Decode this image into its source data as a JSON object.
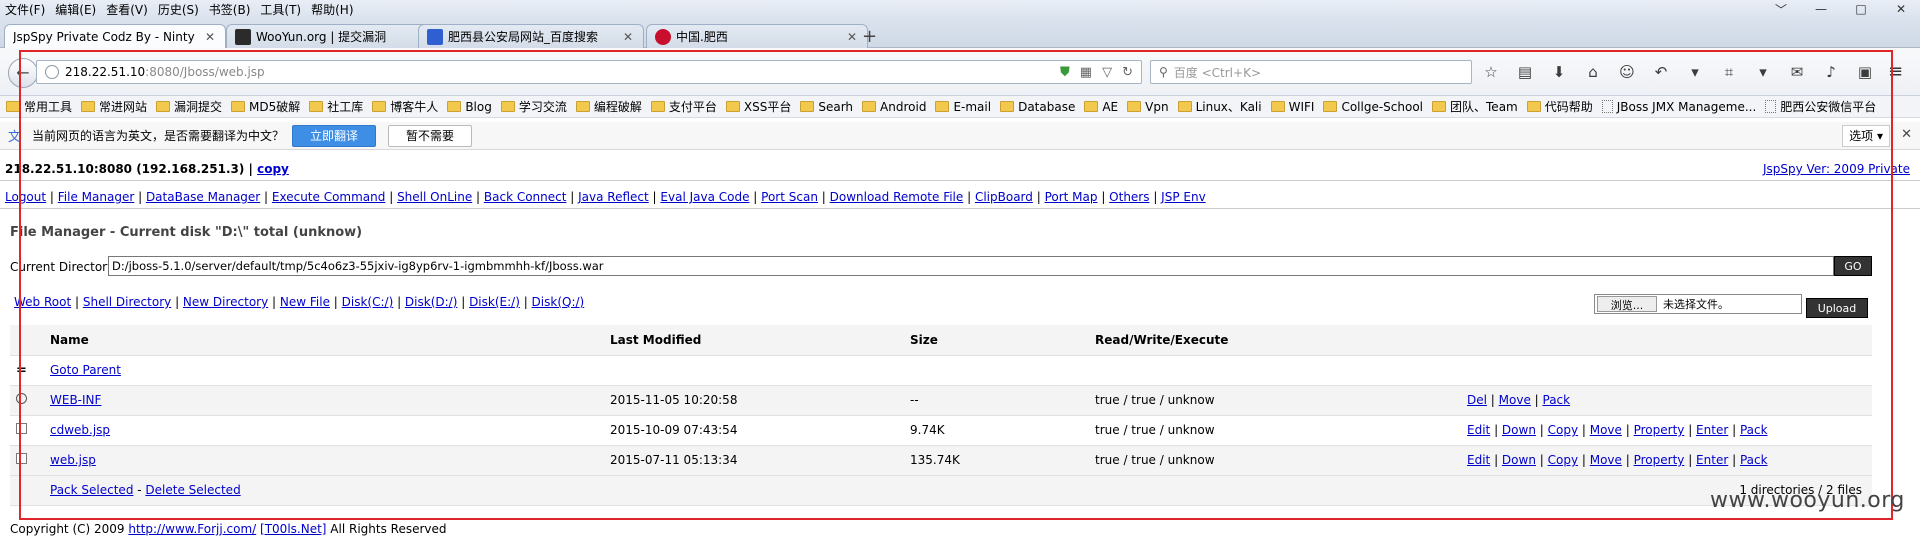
{
  "menubar": {
    "items": [
      "文件(F)",
      "编辑(E)",
      "查看(V)",
      "历史(S)",
      "书签(B)",
      "工具(T)",
      "帮助(H)"
    ],
    "window_controls": [
      "﹀",
      "—",
      "□",
      "✕"
    ]
  },
  "tabs": [
    {
      "label": "JspSpy Private Codz By - Ninty",
      "active": true
    },
    {
      "label": "WooYun.org | 提交漏洞",
      "active": false
    },
    {
      "label": "肥西县公安局网站_百度搜索",
      "active": false
    },
    {
      "label": "中国.肥西",
      "active": false
    }
  ],
  "navbar": {
    "url_host": "218.22.51.10",
    "url_path": ":8080/Jboss/web.jsp",
    "search_placeholder": "百度 <Ctrl+K>"
  },
  "bookmarks": [
    {
      "label": "常用工具",
      "type": "folder"
    },
    {
      "label": "常进网站",
      "type": "folder"
    },
    {
      "label": "漏洞提交",
      "type": "folder"
    },
    {
      "label": "MD5破解",
      "type": "folder"
    },
    {
      "label": "社工库",
      "type": "folder"
    },
    {
      "label": "博客牛人",
      "type": "folder"
    },
    {
      "label": "Blog",
      "type": "folder"
    },
    {
      "label": "学习交流",
      "type": "folder"
    },
    {
      "label": "编程破解",
      "type": "folder"
    },
    {
      "label": "支付平台",
      "type": "folder"
    },
    {
      "label": "XSS平台",
      "type": "folder"
    },
    {
      "label": "Searh",
      "type": "folder"
    },
    {
      "label": "Android",
      "type": "folder"
    },
    {
      "label": "E-mail",
      "type": "folder"
    },
    {
      "label": "Database",
      "type": "folder"
    },
    {
      "label": "AE",
      "type": "folder"
    },
    {
      "label": "Vpn",
      "type": "folder"
    },
    {
      "label": "Linux、Kali",
      "type": "folder"
    },
    {
      "label": "WIFI",
      "type": "folder"
    },
    {
      "label": "Collge-School",
      "type": "folder"
    },
    {
      "label": "团队、Team",
      "type": "folder"
    },
    {
      "label": "代码帮助",
      "type": "folder"
    },
    {
      "label": "JBoss JMX Manageme...",
      "type": "page"
    },
    {
      "label": "肥西公安微信平台",
      "type": "page"
    }
  ],
  "translate_bar": {
    "message": "当前网页的语言为英文，是否需要翻译为中文？",
    "translate_label": "立即翻译",
    "decline_label": "暂不需要",
    "options_label": "选项 ▾"
  },
  "page": {
    "host_text": "218.22.51.10:8080 (192.168.251.3) |",
    "copy_label": "copy",
    "version_label": "JspSpy Ver: 2009 Private",
    "top_links": [
      "Logout",
      "File Manager",
      "DataBase Manager",
      "Execute Command",
      "Shell OnLine",
      "Back Connect",
      "Java Reflect",
      "Eval Java Code",
      "Port Scan",
      "Download Remote File",
      "ClipBoard",
      "Port Map",
      "Others",
      "JSP Env"
    ],
    "fm_title": "File Manager - Current disk \"D:\\\" total (unknow)",
    "current_dir_label": "Current Directory",
    "current_dir_value": "D:/jboss-5.1.0/server/default/tmp/5c4o6z3-55jxiv-ig8yp6rv-1-igmbmmhh-kf/Jboss.war",
    "go_label": "GO",
    "dir_links": [
      "Web Root",
      "Shell Directory",
      "New Directory",
      "New File",
      "Disk(C:/)",
      "Disk(D:/)",
      "Disk(E:/)",
      "Disk(Q:/)"
    ],
    "browse_label": "浏览...",
    "no_file_label": "未选择文件。",
    "upload_label": "Upload"
  },
  "table": {
    "headers": {
      "name": "Name",
      "modified": "Last Modified",
      "size": "Size",
      "rwe": "Read/Write/Execute"
    },
    "goto_parent_label": "Goto Parent",
    "goto_parent_icon": "=",
    "rows": [
      {
        "name": "WEB-INF",
        "modified": "2015-11-05 10:20:58",
        "size": "--",
        "rwe": "true / true / unknow",
        "actions": [
          "Del",
          "Move",
          "Pack"
        ],
        "kind": "dir"
      },
      {
        "name": "cdweb.jsp",
        "modified": "2015-10-09 07:43:54",
        "size": "9.74K",
        "rwe": "true / true / unknow",
        "actions": [
          "Edit",
          "Down",
          "Copy",
          "Move",
          "Property",
          "Enter",
          "Pack"
        ],
        "kind": "file"
      },
      {
        "name": "web.jsp",
        "modified": "2015-07-11 05:13:34",
        "size": "135.74K",
        "rwe": "true / true / unknow",
        "actions": [
          "Edit",
          "Down",
          "Copy",
          "Move",
          "Property",
          "Enter",
          "Pack"
        ],
        "kind": "file"
      }
    ],
    "pack_selected_label": "Pack Selected",
    "delete_selected_label": "Delete Selected",
    "summary": "1 directories / 2 files"
  },
  "footer": {
    "prefix": "Copyright (C) 2009",
    "link1": "http://www.Forjj.com/",
    "link2": "[T00ls.Net]",
    "suffix": "All Rights Reserved"
  },
  "watermark": "www.wooyun.org",
  "colors": {
    "highlight_frame": "#e0252b",
    "link": "#0000cc",
    "translate_button": "#3f8ee6"
  }
}
